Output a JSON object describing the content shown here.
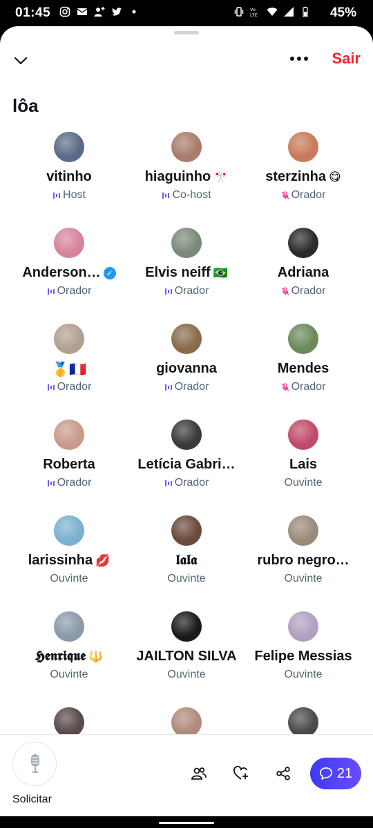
{
  "status_bar": {
    "time": "01:45",
    "battery": "45%",
    "left_icons": [
      "instagram-icon",
      "mail-icon",
      "person-add-icon",
      "twitter-icon",
      "dot-icon"
    ],
    "right_icons": [
      "vibrate-icon",
      "volte-icon",
      "wifi-icon",
      "signal-icon",
      "battery-icon"
    ]
  },
  "header": {
    "leave_label": "Sair",
    "room_title": "lôa"
  },
  "participants": [
    {
      "name": "vitinho",
      "role": "Host",
      "role_icon": "speaking-icon",
      "avatar_color": "#5a6a88"
    },
    {
      "name": "hiaguinho",
      "badge": "🎌",
      "role": "Co-host",
      "role_icon": "speaking-icon",
      "avatar_color": "#a87b6a"
    },
    {
      "name": "sterzinha",
      "badge": "😋",
      "role": "Orador",
      "role_icon": "mic-muted-icon",
      "avatar_color": "#c87a5a"
    },
    {
      "name": "Anderson…",
      "verified": true,
      "role": "Orador",
      "role_icon": "speaking-icon",
      "avatar_color": "#d6849a"
    },
    {
      "name": "Elvis neiff",
      "badge": "🇧🇷",
      "role": "Orador",
      "role_icon": "speaking-icon",
      "avatar_color": "#7a8a7a"
    },
    {
      "name": "Adriana",
      "badge": "",
      "role": "Orador",
      "role_icon": "mic-muted-icon",
      "avatar_color": "#2a2a2a"
    },
    {
      "name": "🥇🇫🇷",
      "role": "Orador",
      "role_icon": "speaking-icon",
      "avatar_color": "#b0a090"
    },
    {
      "name": "giovanna",
      "role": "Orador",
      "role_icon": "speaking-icon",
      "avatar_color": "#8a6a4a"
    },
    {
      "name": "Mendes",
      "role": "Orador",
      "role_icon": "mic-muted-icon",
      "avatar_color": "#6a8a5a"
    },
    {
      "name": "Roberta",
      "role": "Orador",
      "role_icon": "speaking-icon",
      "avatar_color": "#c89a8a"
    },
    {
      "name": "Letícia Gabri…",
      "role": "Orador",
      "role_icon": "speaking-icon",
      "avatar_color": "#3a3a3a"
    },
    {
      "name": "Lais",
      "role": "Ouvinte",
      "role_icon": "",
      "avatar_color": "#c04a6a"
    },
    {
      "name": "larissinha",
      "badge": "💋",
      "role": "Ouvinte",
      "role_icon": "",
      "avatar_color": "#7ab0d0"
    },
    {
      "name": "𝖑𝖆𝖑𝖆",
      "role": "Ouvinte",
      "role_icon": "",
      "avatar_color": "#6a4a3a"
    },
    {
      "name": "rubro negro…",
      "role": "Ouvinte",
      "role_icon": "",
      "avatar_color": "#9a8a7a"
    },
    {
      "name": "𝕳𝖊𝖓𝖗𝖎𝖖𝖚𝖊",
      "badge": "🔱",
      "role": "Ouvinte",
      "role_icon": "",
      "avatar_color": "#8a9aaa"
    },
    {
      "name": "JAILTON SILVA",
      "role": "Ouvinte",
      "role_icon": "",
      "avatar_color": "#1a1a1a"
    },
    {
      "name": "Felipe Messias",
      "role": "Ouvinte",
      "role_icon": "",
      "avatar_color": "#b0a0c0"
    },
    {
      "name": "",
      "role": "",
      "role_icon": "",
      "avatar_color": "#5a4a4a"
    },
    {
      "name": "",
      "role": "",
      "role_icon": "",
      "avatar_color": "#b08a7a"
    },
    {
      "name": "",
      "role": "",
      "role_icon": "",
      "avatar_color": "#4a4a4a"
    }
  ],
  "bottom_bar": {
    "request_label": "Solicitar",
    "chat_count": "21",
    "icons": [
      "mic-icon",
      "people-icon",
      "heart-add-icon",
      "share-icon",
      "chat-icon"
    ]
  },
  "colors": {
    "accent_red": "#f4212e",
    "speaking_purple": "#7856ff",
    "muted_pink": "#f91880",
    "chat_gradient_start": "#3b3bf0",
    "chat_gradient_end": "#6d4bff",
    "verified_blue": "#1d9bf0"
  }
}
